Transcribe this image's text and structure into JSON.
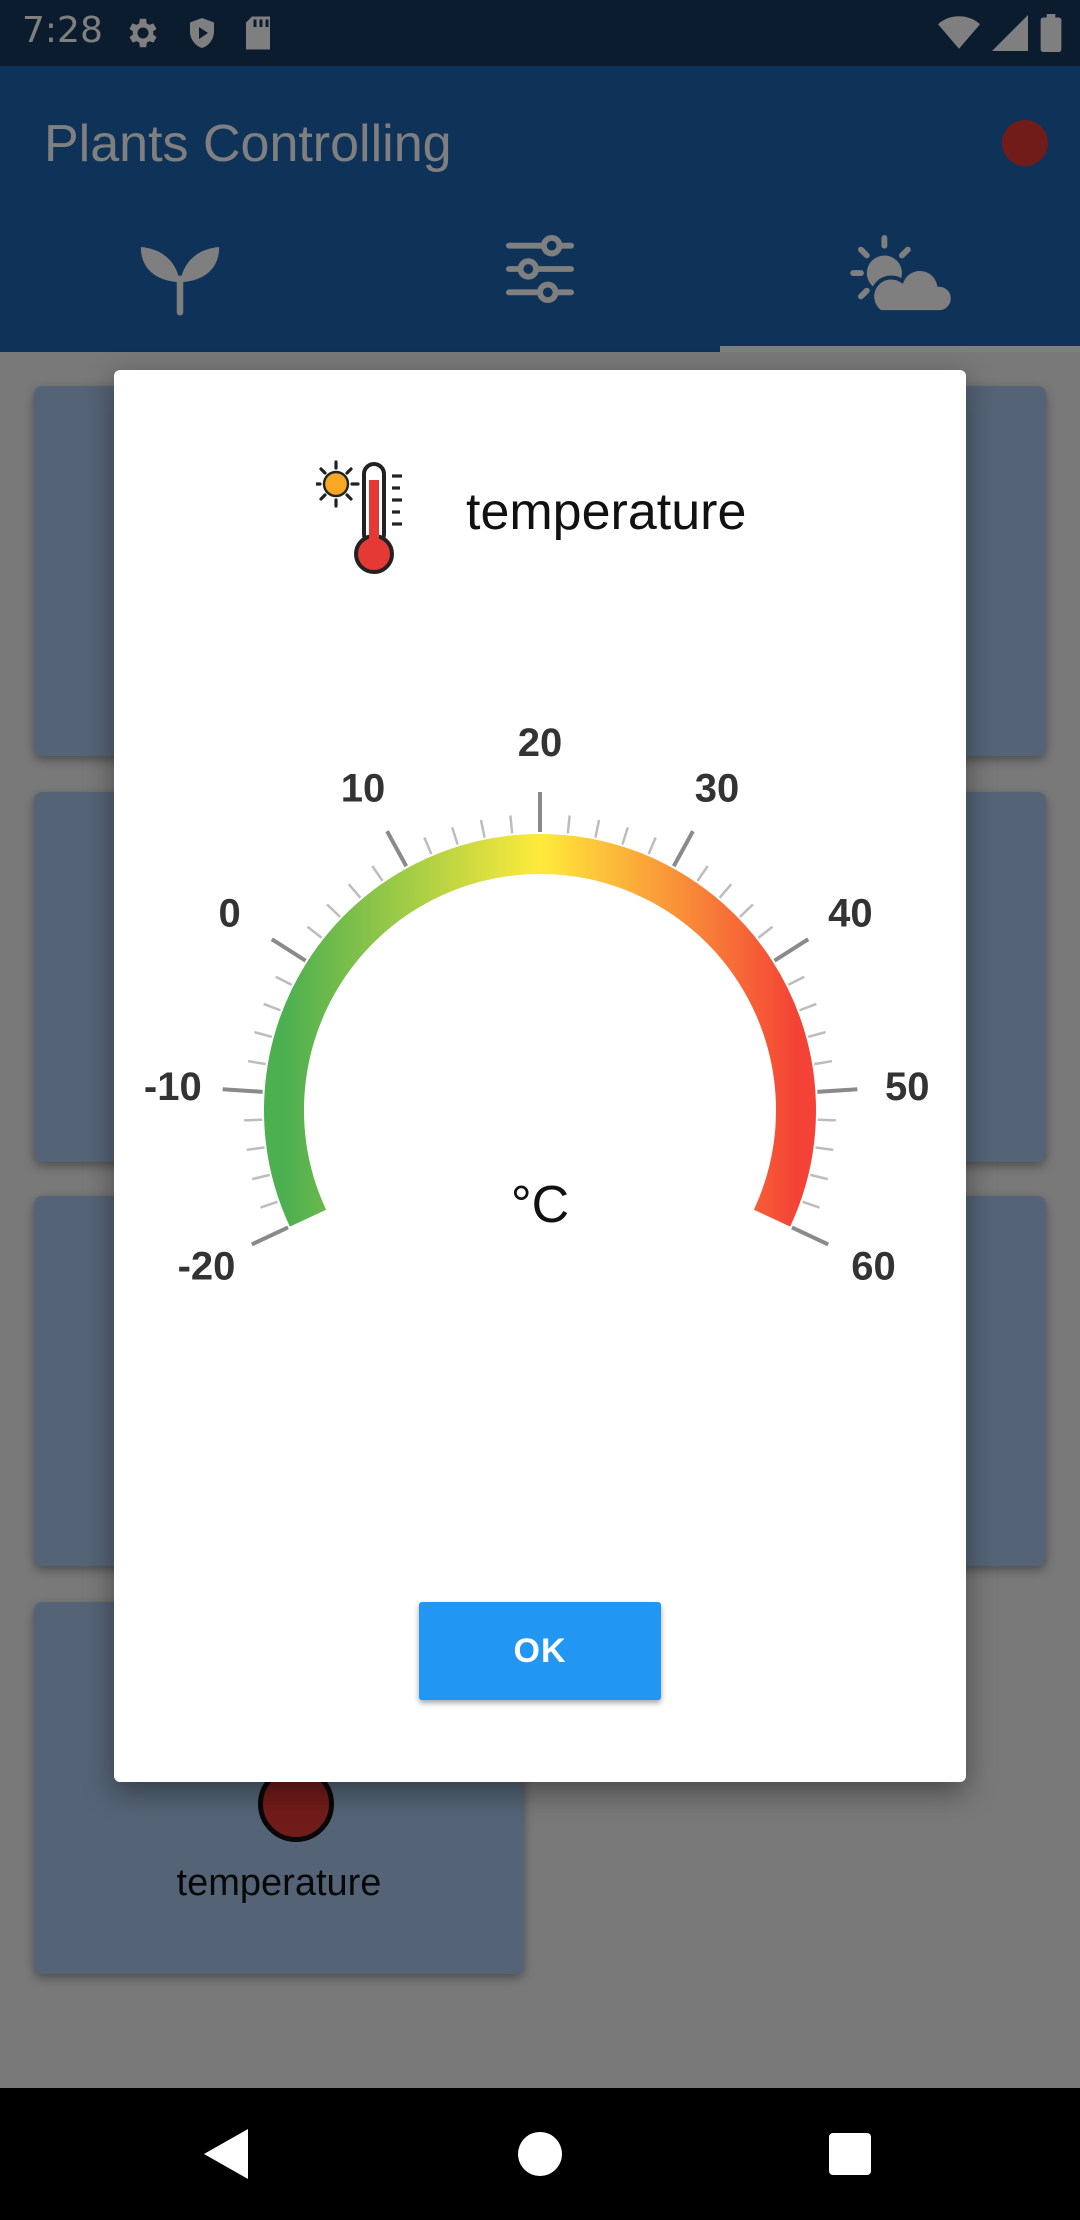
{
  "status_bar": {
    "time": "7:28",
    "left_icons": [
      "gear-icon",
      "shield-icon",
      "sd-card-icon"
    ],
    "right_icons": [
      "wifi-icon",
      "signal-icon",
      "battery-icon"
    ]
  },
  "app_bar": {
    "title": "Plants Controlling",
    "status_dot_color": "#e53935",
    "tabs": [
      {
        "icon": "plant-icon"
      },
      {
        "icon": "sliders-icon"
      },
      {
        "icon": "weather-icon",
        "selected": true
      }
    ]
  },
  "background": {
    "card_label": "temperature"
  },
  "dialog": {
    "title": "temperature",
    "icon": "thermometer-sun-icon",
    "gauge": {
      "unit": "°C",
      "min": -20,
      "max": 60,
      "major_ticks": [
        "-20",
        "-10",
        "0",
        "10",
        "20",
        "30",
        "40",
        "50",
        "60"
      ],
      "minor_per_major": 5,
      "color_stops": [
        "#4caf50",
        "#ffeb3b",
        "#f44336"
      ]
    },
    "ok_label": "OK"
  },
  "nav_bar": {
    "buttons": [
      "back-icon",
      "home-icon",
      "recents-icon"
    ]
  }
}
